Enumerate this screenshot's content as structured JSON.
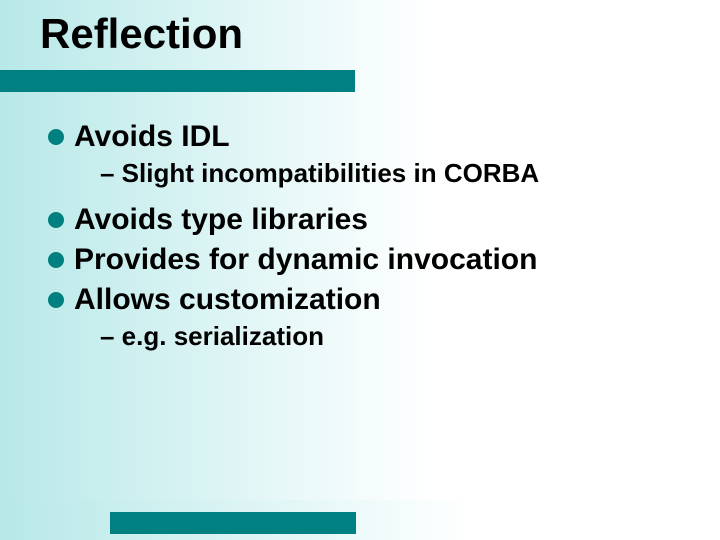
{
  "title": "Reflection",
  "bullets": [
    {
      "text": "Avoids IDL",
      "subs": [
        "– Slight incompatibilities in CORBA"
      ]
    },
    {
      "text": "Avoids type libraries",
      "subs": []
    },
    {
      "text": "Provides for dynamic invocation",
      "subs": []
    },
    {
      "text": "Allows customization",
      "subs": [
        "– e.g. serialization"
      ]
    }
  ]
}
